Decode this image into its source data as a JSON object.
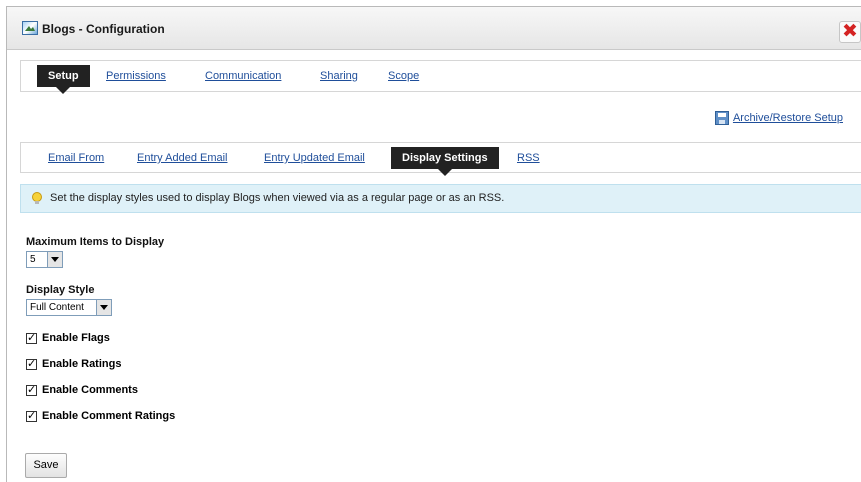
{
  "window": {
    "title": "Blogs - Configuration"
  },
  "top_tabs": [
    {
      "label": "Setup",
      "active": true
    },
    {
      "label": "Permissions",
      "active": false
    },
    {
      "label": "Communication",
      "active": false
    },
    {
      "label": "Sharing",
      "active": false
    },
    {
      "label": "Scope",
      "active": false
    }
  ],
  "archive_link": {
    "label": "Archive/Restore Setup"
  },
  "sub_tabs": [
    {
      "label": "Email From",
      "active": false
    },
    {
      "label": "Entry Added Email",
      "active": false
    },
    {
      "label": "Entry Updated Email",
      "active": false
    },
    {
      "label": "Display Settings",
      "active": true
    },
    {
      "label": "RSS",
      "active": false
    }
  ],
  "info": {
    "message": "Set the display styles used to display Blogs when viewed via as a regular page or as an RSS."
  },
  "form": {
    "max_items": {
      "label": "Maximum Items to Display",
      "value": "5"
    },
    "display_style": {
      "label": "Display Style",
      "value": "Full Content"
    },
    "checkboxes": [
      {
        "label": "Enable Flags",
        "checked": true
      },
      {
        "label": "Enable Ratings",
        "checked": true
      },
      {
        "label": "Enable Comments",
        "checked": true
      },
      {
        "label": "Enable Comment Ratings",
        "checked": true
      }
    ],
    "save_label": "Save"
  },
  "colors": {
    "link": "#1f4e9a",
    "active_tab_bg": "#222222",
    "info_bg": "#dff1f8",
    "close_x": "#d42222"
  },
  "icons": {
    "title": "blog-window-icon",
    "close": "close-icon",
    "archive": "save-disk-icon",
    "info": "lightbulb-icon"
  }
}
